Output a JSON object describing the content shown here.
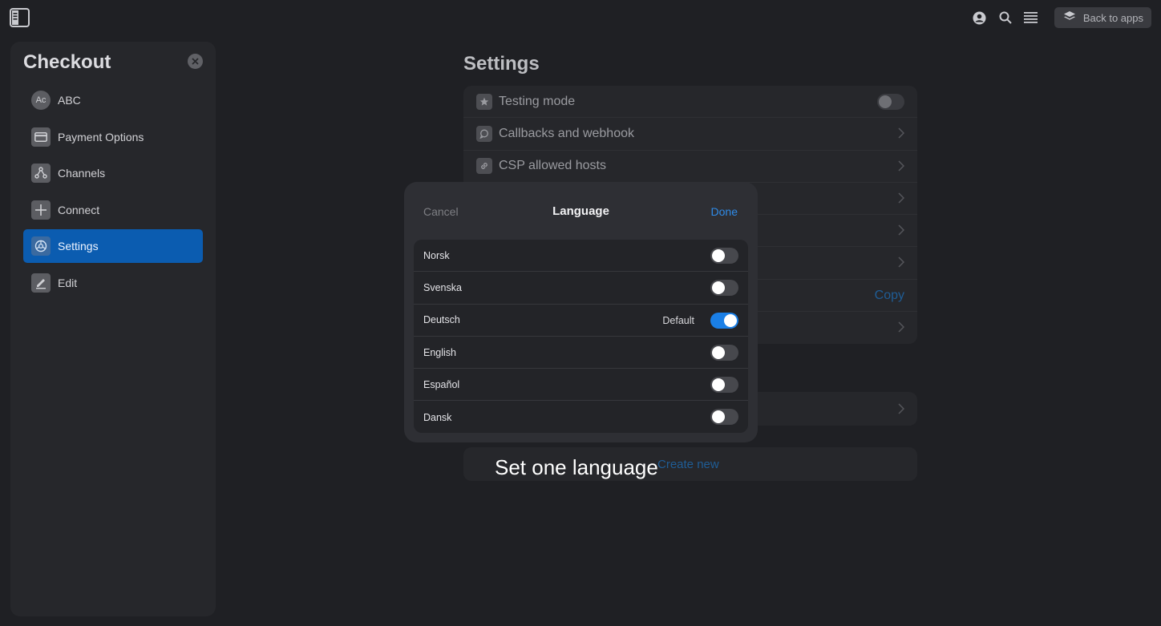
{
  "topbar": {
    "back_label": "Back to apps"
  },
  "sidebar": {
    "title": "Checkout",
    "items": [
      {
        "label": "ABC",
        "icon": "avatar-icon",
        "badge": "Ac",
        "active": false
      },
      {
        "label": "Payment Options",
        "icon": "credit-card-icon",
        "active": false
      },
      {
        "label": "Channels",
        "icon": "channels-icon",
        "active": false
      },
      {
        "label": "Connect",
        "icon": "plus-icon",
        "active": false
      },
      {
        "label": "Settings",
        "icon": "settings-icon",
        "active": true
      },
      {
        "label": "Edit",
        "icon": "edit-icon",
        "active": false
      }
    ]
  },
  "settings": {
    "title": "Settings",
    "rows": [
      {
        "label": "Testing mode",
        "control": "toggle",
        "icon": "star-icon"
      },
      {
        "label": "Callbacks and webhook",
        "control": "chevron",
        "icon": "webhook-icon"
      },
      {
        "label": "CSP allowed hosts",
        "control": "chevron",
        "icon": "link-icon"
      }
    ],
    "copy_label": "Copy",
    "create_new_label": "Create new"
  },
  "modal": {
    "cancel_label": "Cancel",
    "title": "Language",
    "done_label": "Done",
    "default_label": "Default",
    "languages": [
      {
        "name": "Norsk",
        "enabled": false
      },
      {
        "name": "Svenska",
        "enabled": false
      },
      {
        "name": "Deutsch",
        "enabled": true,
        "default": true
      },
      {
        "name": "English",
        "enabled": false
      },
      {
        "name": "Español",
        "enabled": false
      },
      {
        "name": "Dansk",
        "enabled": false
      }
    ]
  },
  "caption": "Set one language",
  "colors": {
    "accent": "#1a7fe6",
    "sidebar_active": "#0b5cb0",
    "background": "#1f2024"
  }
}
